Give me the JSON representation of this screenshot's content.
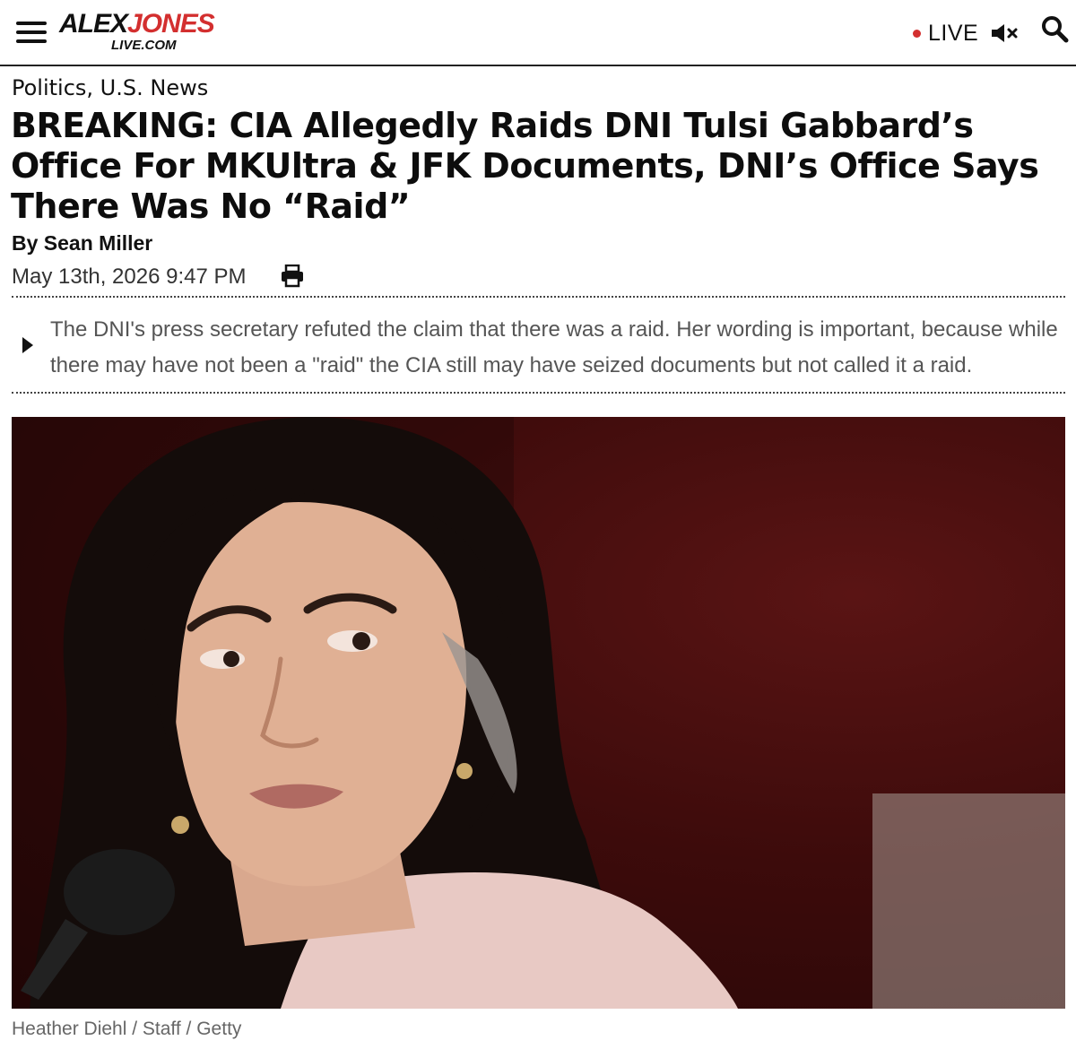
{
  "header": {
    "logo_top_left": "ALEX",
    "logo_top_right": "JONES",
    "logo_bottom": "LIVE.COM",
    "live_label": "LIVE",
    "icons": [
      "menu-icon",
      "mute-icon",
      "search-icon"
    ],
    "accent_color": "#d32f2f"
  },
  "article": {
    "category": "Politics, U.S. News",
    "headline": "BREAKING: CIA Allegedly Raids DNI Tulsi Gabbard’s Office For MKUltra & JFK Documents, DNI’s Office Says There Was No “Raid”",
    "byline": "By Sean Miller",
    "date": "May 13th, 2026 9:47 PM",
    "summary": "The DNI's press secretary refuted the claim that there was a raid. Her wording is important, because while there may have not been a \"raid\" the CIA still may have seized documents but not called it a raid.",
    "photo_caption": "Heather Diehl / Staff / Getty"
  }
}
